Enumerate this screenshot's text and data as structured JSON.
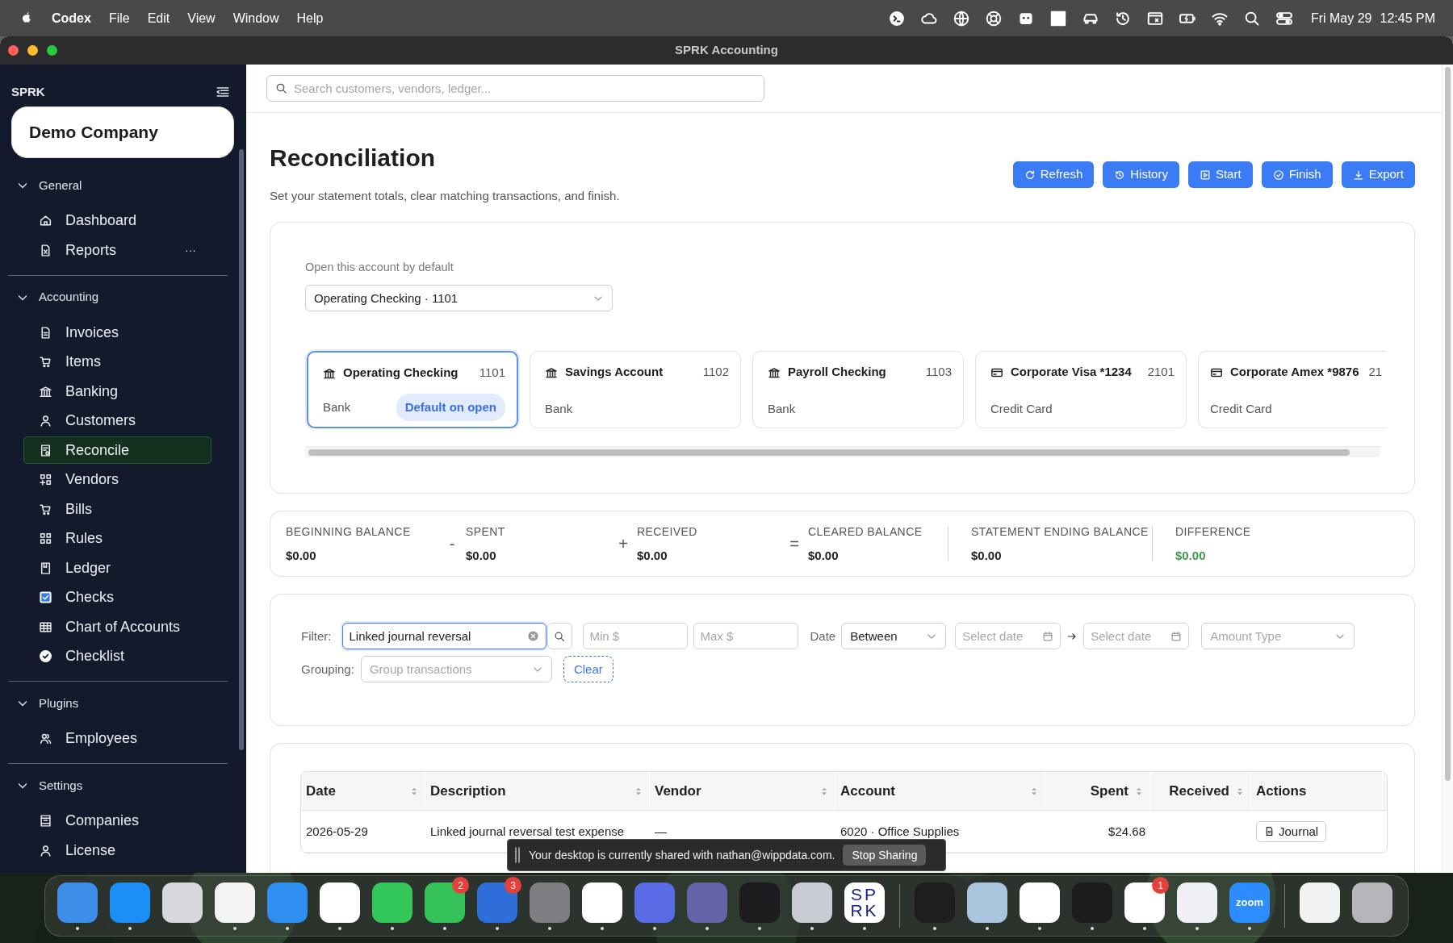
{
  "menu_bar": {
    "app": "Codex",
    "menus": [
      "File",
      "Edit",
      "View",
      "Window",
      "Help"
    ],
    "date": "Fri May 29",
    "time": "12:45 PM"
  },
  "window": {
    "title": "SPRK Accounting"
  },
  "sidebar": {
    "brand": "SPRK",
    "company": "Demo Company",
    "sections": [
      {
        "label": "General",
        "expanded": true,
        "items": [
          {
            "label": "Dashboard",
            "selected": false
          },
          {
            "label": "Reports",
            "selected": false,
            "more": "···"
          }
        ]
      },
      {
        "label": "Accounting",
        "expanded": true,
        "items": [
          {
            "label": "Invoices",
            "selected": false
          },
          {
            "label": "Items",
            "selected": false
          },
          {
            "label": "Banking",
            "selected": false
          },
          {
            "label": "Customers",
            "selected": false
          },
          {
            "label": "Reconcile",
            "selected": true
          },
          {
            "label": "Vendors",
            "selected": false
          },
          {
            "label": "Bills",
            "selected": false
          },
          {
            "label": "Rules",
            "selected": false
          },
          {
            "label": "Ledger",
            "selected": false
          },
          {
            "label": "Checks",
            "selected": false
          },
          {
            "label": "Chart of Accounts",
            "selected": false
          },
          {
            "label": "Checklist",
            "selected": false
          }
        ]
      },
      {
        "label": "Plugins",
        "expanded": true,
        "items": [
          {
            "label": "Employees",
            "selected": false
          }
        ]
      },
      {
        "label": "Settings",
        "expanded": true,
        "items": [
          {
            "label": "Companies",
            "selected": false
          },
          {
            "label": "License",
            "selected": false
          }
        ]
      }
    ]
  },
  "search": {
    "placeholder": "Search customers, vendors, ledger..."
  },
  "page": {
    "title": "Reconciliation",
    "subtitle": "Set your statement totals, clear matching transactions, and finish.",
    "actions": [
      "Refresh",
      "History",
      "Start",
      "Finish",
      "Export"
    ]
  },
  "account_picker": {
    "label": "Open this account by default",
    "value": "Operating Checking · 1101"
  },
  "accounts": [
    {
      "kind": "bank",
      "name": "Operating Checking",
      "number": "1101",
      "type": "Bank",
      "selected": true,
      "badge": "Default on open"
    },
    {
      "kind": "bank",
      "name": "Savings Account",
      "number": "1102",
      "type": "Bank",
      "selected": false
    },
    {
      "kind": "bank",
      "name": "Payroll Checking",
      "number": "1103",
      "type": "Bank",
      "selected": false
    },
    {
      "kind": "card",
      "name": "Corporate Visa *1234",
      "number": "2101",
      "type": "Credit Card",
      "selected": false
    },
    {
      "kind": "card",
      "name": "Corporate Amex *9876",
      "number": "21",
      "type": "Credit Card",
      "selected": false
    }
  ],
  "summary": [
    {
      "label": "BEGINNING BALANCE",
      "value": "$0.00"
    },
    {
      "operator": "-",
      "label": "SPENT",
      "value": "$0.00"
    },
    {
      "operator": "+",
      "label": "RECEIVED",
      "value": "$0.00"
    },
    {
      "operator": "=",
      "label": "CLEARED BALANCE",
      "value": "$0.00"
    },
    {
      "separated": true,
      "label": "STATEMENT ENDING BALANCE",
      "value": "$0.00"
    },
    {
      "separated": true,
      "label": "DIFFERENCE",
      "value": "$0.00",
      "color": "#3f9a4f"
    }
  ],
  "filters": {
    "filter_label": "Filter:",
    "filter_value": "Linked journal reversal",
    "min_placeholder": "Min $",
    "max_placeholder": "Max $",
    "date_label": "Date",
    "date_mode": "Between",
    "date_from_placeholder": "Select date",
    "date_to_placeholder": "Select date",
    "amount_type_placeholder": "Amount Type",
    "grouping_label": "Grouping:",
    "grouping_placeholder": "Group transactions",
    "clear": "Clear"
  },
  "table": {
    "columns": [
      {
        "label": "Date",
        "sortable": true
      },
      {
        "label": "Description",
        "sortable": true
      },
      {
        "label": "Vendor",
        "sortable": true
      },
      {
        "label": "Account",
        "sortable": true
      },
      {
        "label": "Spent",
        "sortable": true
      },
      {
        "label": "Received",
        "sortable": true
      },
      {
        "label": "Actions",
        "sortable": false
      }
    ],
    "rows": [
      {
        "cells": [
          "2026-05-29",
          "Linked journal reversal test expense",
          "—",
          "6020 · Office Supplies",
          "$24.68",
          null
        ],
        "action": "Journal"
      }
    ]
  },
  "share_banner": {
    "text": "Your desktop is currently shared with nathan@wippdata.com.",
    "button": "Stop Sharing"
  },
  "dock": {
    "groups": [
      [
        {
          "color": "#3d8ee8",
          "running": true
        },
        {
          "color": "#1c8ef5",
          "running": true
        },
        {
          "color": "#d8d8dc",
          "running": false
        },
        {
          "color": "#f4f4f4",
          "running": true
        },
        {
          "color": "#2f8ff0",
          "running": true
        },
        {
          "color": "#ffffff",
          "running": true
        },
        {
          "color": "#34c759",
          "running": true
        },
        {
          "color": "#35c15a",
          "running": true,
          "badge": "2"
        },
        {
          "color": "#2d6ed8",
          "running": true,
          "badge": "3"
        },
        {
          "color": "#7d7d82",
          "running": true
        },
        {
          "color": "#ffffff",
          "running": true
        },
        {
          "color": "#5a6be6",
          "running": true
        },
        {
          "color": "#6264a7",
          "running": true
        },
        {
          "color": "#1d1d1f",
          "running": true
        },
        {
          "color": "#c9cdd3",
          "running": true
        },
        {
          "color": "#ffffff",
          "running": true,
          "label": "SPRK"
        }
      ],
      [
        {
          "color": "#1e1e1e",
          "running": true
        },
        {
          "color": "#a9c5de",
          "running": true
        },
        {
          "color": "#ffffff",
          "running": true
        },
        {
          "color": "#1c1c1e",
          "running": true
        },
        {
          "color": "#ffffff",
          "running": true,
          "badge": "1"
        },
        {
          "color": "#eef0f3",
          "running": true
        },
        {
          "color": "#2d8cff",
          "running": true,
          "label": "zoom"
        }
      ],
      [
        {
          "color": "#f2f2f2",
          "running": false
        },
        {
          "color": "#b4b6b9",
          "running": false
        }
      ]
    ]
  }
}
